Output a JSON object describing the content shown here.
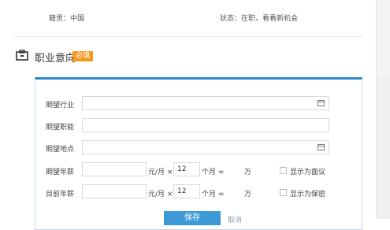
{
  "top_cut": {
    "left_text": "籍贯：中国",
    "right_text": "状态：在职，看看新机会"
  },
  "section": {
    "title": "职业意向",
    "required_badge": "必填"
  },
  "form": {
    "rows": [
      {
        "label": "期望行业",
        "placeholder": ""
      },
      {
        "label": "期望职能",
        "placeholder": ""
      },
      {
        "label": "期望地点",
        "placeholder": ""
      },
      {
        "label": "期望年薪",
        "unit": "元/月 ×",
        "months": "12",
        "months_suffix": "个月 =",
        "result_unit": "万",
        "checkbox_label": "显示为面议"
      },
      {
        "label": "目前年薪",
        "unit": "元/月 ×",
        "months": "12",
        "months_suffix": "个月 =",
        "result_unit": "万",
        "checkbox_label": "显示为保密"
      }
    ],
    "save_label": "保存",
    "cancel_label": "取消"
  },
  "colors": {
    "accent": "#2b88c8",
    "badge": "#f39a1f"
  }
}
